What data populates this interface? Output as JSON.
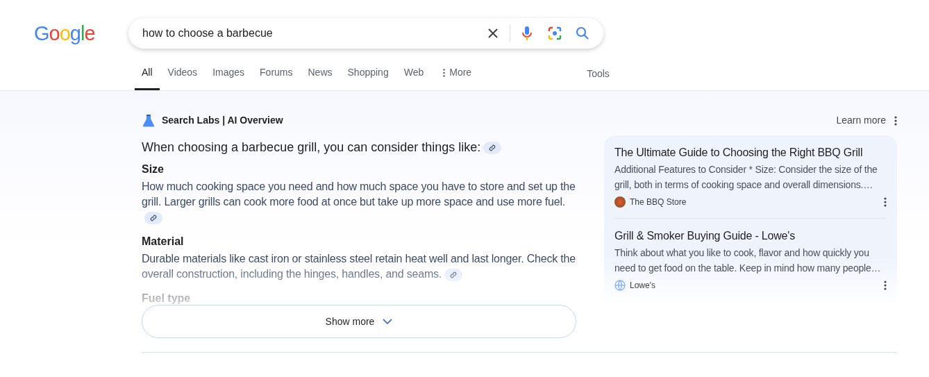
{
  "logo": "Google",
  "search": {
    "value": "how to choose a barbecue"
  },
  "tabs": [
    {
      "label": "All",
      "selected": true,
      "kind": "tab"
    },
    {
      "label": "Videos",
      "selected": false,
      "kind": "tab"
    },
    {
      "label": "Images",
      "selected": false,
      "kind": "tab"
    },
    {
      "label": "Forums",
      "selected": false,
      "kind": "tab"
    },
    {
      "label": "News",
      "selected": false,
      "kind": "tab"
    },
    {
      "label": "Shopping",
      "selected": false,
      "kind": "tab"
    },
    {
      "label": "Web",
      "selected": false,
      "kind": "tab"
    },
    {
      "label": "More",
      "selected": false,
      "kind": "menu"
    }
  ],
  "tools": "Tools",
  "ai_overview": {
    "title": "Search Labs | AI Overview",
    "learn_more": "Learn more",
    "intro": "When choosing a barbecue grill, you can consider things like:",
    "sections": [
      {
        "heading": "Size",
        "text": "How much cooking space you need and how much space you have to store and set up the grill. Larger grills can cook more food at once but take up more space and use more fuel."
      },
      {
        "heading": "Material",
        "text": "Durable materials like cast iron or stainless steel retain heat well and last longer. Check the overall construction, including the hinges, handles, and seams."
      },
      {
        "heading": "Fuel type"
      }
    ],
    "show_more": "Show more"
  },
  "sources": [
    {
      "title": "The Ultimate Guide to Choosing the Right BBQ Grill",
      "snippet": "Additional Features to Consider * Size: Consider the size of the grill, both in terms of cooking space and overall dimensions.…",
      "site": "The BBQ Store",
      "kind": "logo"
    },
    {
      "title": "Grill & Smoker Buying Guide - Lowe's",
      "snippet": "Think about what you like to cook, flavor and how quickly you need to get food on the table. Keep in mind how many people…",
      "site": "Lowe's",
      "kind": "globe"
    }
  ]
}
